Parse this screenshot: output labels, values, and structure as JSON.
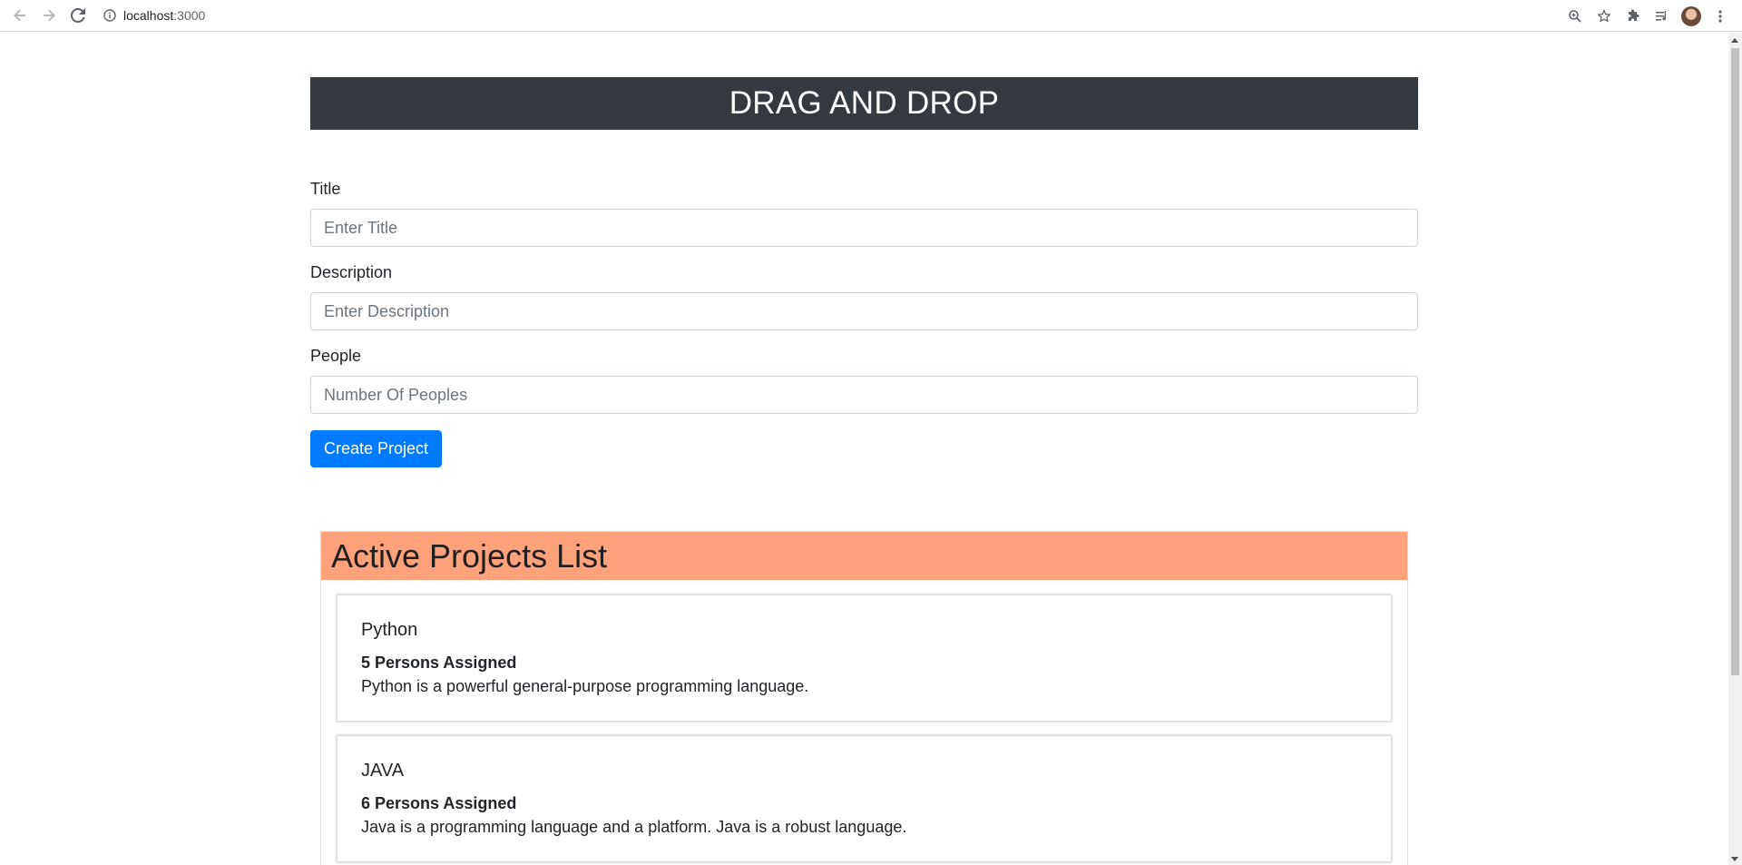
{
  "browser": {
    "url_host": "localhost",
    "url_port": ":3000"
  },
  "header": {
    "title": "DRAG AND DROP"
  },
  "form": {
    "title_label": "Title",
    "title_placeholder": "Enter Title",
    "description_label": "Description",
    "description_placeholder": "Enter Description",
    "people_label": "People",
    "people_placeholder": "Number Of Peoples",
    "submit_label": "Create Project"
  },
  "active_projects": {
    "heading": "Active Projects List",
    "items": [
      {
        "title": "Python",
        "people": "5 Persons Assigned",
        "description": "Python is a powerful general-purpose programming language."
      },
      {
        "title": "JAVA",
        "people": "6 Persons Assigned",
        "description": "Java is a programming language and a platform. Java is a robust language."
      }
    ]
  },
  "colors": {
    "banner_bg": "#343a40",
    "list_header_bg": "#ffa27b",
    "button_bg": "#007bff"
  }
}
